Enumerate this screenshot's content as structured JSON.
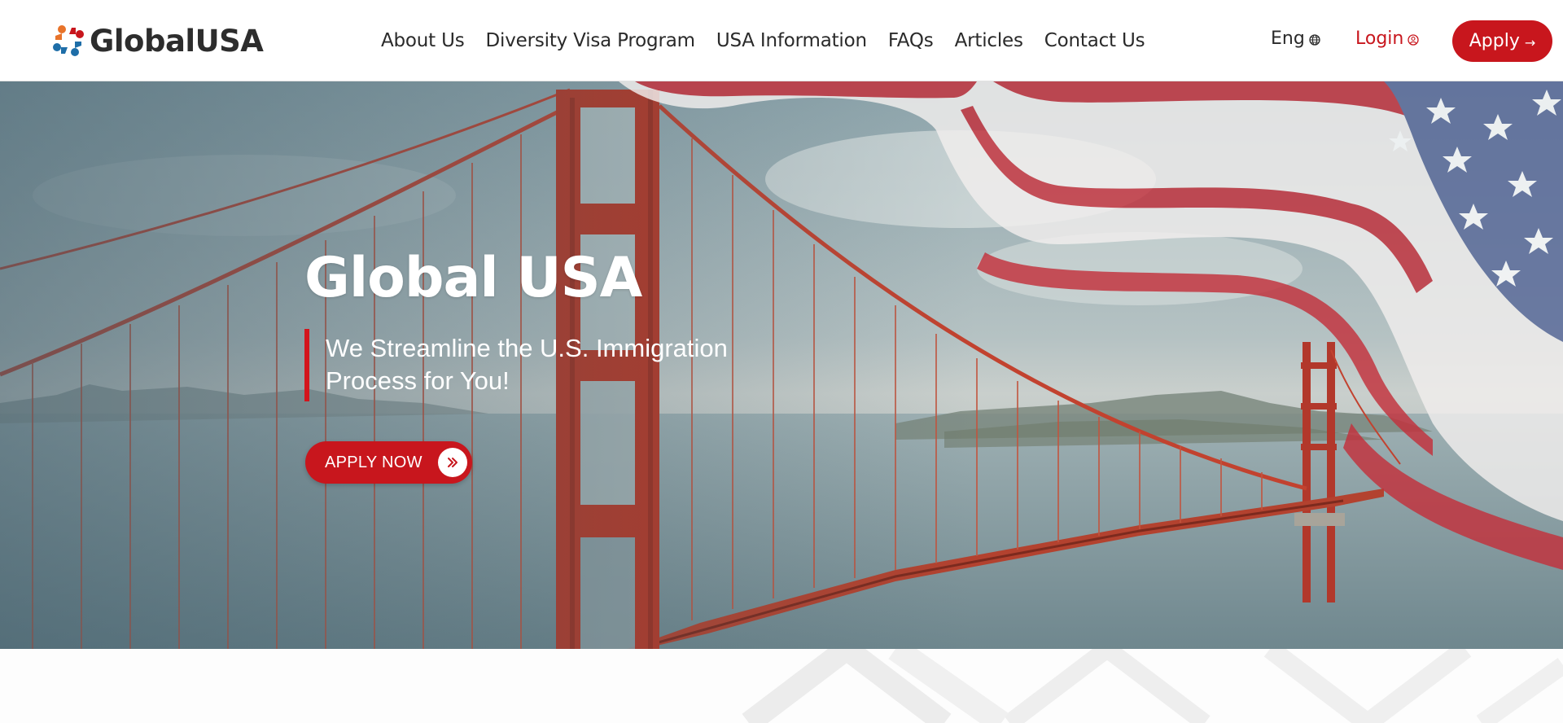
{
  "brand": {
    "name": "GlobalUSA",
    "colors": {
      "primary_red": "#c8161d",
      "accent_blue": "#1e6ea8",
      "accent_orange": "#e8732a",
      "text_dark": "#2a2a2a"
    }
  },
  "nav": {
    "items": [
      {
        "label": "About Us"
      },
      {
        "label": "Diversity Visa Program"
      },
      {
        "label": "USA Information"
      },
      {
        "label": "FAQs"
      },
      {
        "label": "Articles"
      },
      {
        "label": "Contact Us"
      }
    ]
  },
  "header_actions": {
    "language": {
      "label": "Eng",
      "icon": "globe-icon"
    },
    "login": {
      "label": "Login",
      "icon": "user-circle-icon"
    },
    "apply": {
      "label": "Apply",
      "icon": "arrow-right-icon"
    }
  },
  "hero": {
    "title": "Global USA",
    "subtitle": "We Streamline the U.S. Immigration Process for You!",
    "cta": {
      "label": "APPLY NOW",
      "icon": "double-chevron-right-icon"
    },
    "background": "golden-gate-bridge-with-us-flag"
  }
}
